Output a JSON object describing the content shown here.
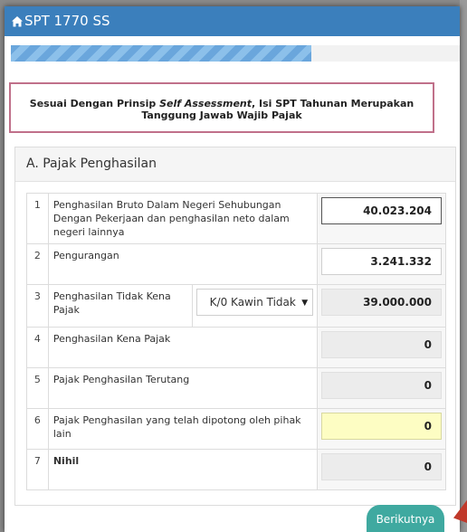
{
  "window": {
    "title": "SPT 1770 SS"
  },
  "progress": {
    "percent": 67
  },
  "notice": {
    "prefix": "Sesuai Dengan Prinsip ",
    "emphasis": "Self Assessment",
    "suffix": ", Isi SPT Tahunan Merupakan Tanggung Jawab Wajib Pajak"
  },
  "section": {
    "title": "A. Pajak Penghasilan"
  },
  "rows": [
    {
      "no": "1",
      "label": "Penghasilan Bruto Dalam Negeri Sehubungan Dengan Pekerjaan dan penghasilan neto dalam negeri lainnya",
      "value": "40.023.204"
    },
    {
      "no": "2",
      "label": "Pengurangan",
      "value": "3.241.332"
    },
    {
      "no": "3",
      "label": "Penghasilan Tidak Kena Pajak",
      "select": "K/0 Kawin Tidak",
      "value": "39.000.000"
    },
    {
      "no": "4",
      "label": "Penghasilan Kena Pajak",
      "value": "0"
    },
    {
      "no": "5",
      "label": "Pajak Penghasilan Terutang",
      "value": "0"
    },
    {
      "no": "6",
      "label": "Pajak Penghasilan yang telah dipotong oleh pihak lain",
      "value": "0"
    },
    {
      "no": "7",
      "label": "Nihil",
      "value": "0"
    }
  ],
  "buttons": {
    "next": "Berikutnya"
  },
  "colors": {
    "header": "#3b7fbc",
    "button": "#3fa9a0",
    "highlight": "#fdfdc3"
  }
}
